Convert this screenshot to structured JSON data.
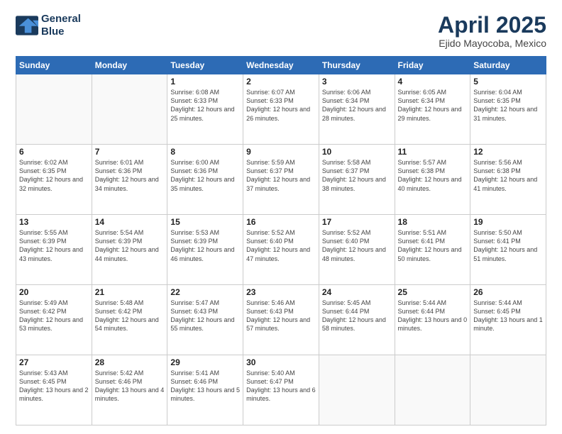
{
  "header": {
    "logo_line1": "General",
    "logo_line2": "Blue",
    "title": "April 2025",
    "subtitle": "Ejido Mayocoba, Mexico"
  },
  "days_of_week": [
    "Sunday",
    "Monday",
    "Tuesday",
    "Wednesday",
    "Thursday",
    "Friday",
    "Saturday"
  ],
  "weeks": [
    [
      {
        "num": "",
        "info": ""
      },
      {
        "num": "",
        "info": ""
      },
      {
        "num": "1",
        "info": "Sunrise: 6:08 AM\nSunset: 6:33 PM\nDaylight: 12 hours and 25 minutes."
      },
      {
        "num": "2",
        "info": "Sunrise: 6:07 AM\nSunset: 6:33 PM\nDaylight: 12 hours and 26 minutes."
      },
      {
        "num": "3",
        "info": "Sunrise: 6:06 AM\nSunset: 6:34 PM\nDaylight: 12 hours and 28 minutes."
      },
      {
        "num": "4",
        "info": "Sunrise: 6:05 AM\nSunset: 6:34 PM\nDaylight: 12 hours and 29 minutes."
      },
      {
        "num": "5",
        "info": "Sunrise: 6:04 AM\nSunset: 6:35 PM\nDaylight: 12 hours and 31 minutes."
      }
    ],
    [
      {
        "num": "6",
        "info": "Sunrise: 6:02 AM\nSunset: 6:35 PM\nDaylight: 12 hours and 32 minutes."
      },
      {
        "num": "7",
        "info": "Sunrise: 6:01 AM\nSunset: 6:36 PM\nDaylight: 12 hours and 34 minutes."
      },
      {
        "num": "8",
        "info": "Sunrise: 6:00 AM\nSunset: 6:36 PM\nDaylight: 12 hours and 35 minutes."
      },
      {
        "num": "9",
        "info": "Sunrise: 5:59 AM\nSunset: 6:37 PM\nDaylight: 12 hours and 37 minutes."
      },
      {
        "num": "10",
        "info": "Sunrise: 5:58 AM\nSunset: 6:37 PM\nDaylight: 12 hours and 38 minutes."
      },
      {
        "num": "11",
        "info": "Sunrise: 5:57 AM\nSunset: 6:38 PM\nDaylight: 12 hours and 40 minutes."
      },
      {
        "num": "12",
        "info": "Sunrise: 5:56 AM\nSunset: 6:38 PM\nDaylight: 12 hours and 41 minutes."
      }
    ],
    [
      {
        "num": "13",
        "info": "Sunrise: 5:55 AM\nSunset: 6:39 PM\nDaylight: 12 hours and 43 minutes."
      },
      {
        "num": "14",
        "info": "Sunrise: 5:54 AM\nSunset: 6:39 PM\nDaylight: 12 hours and 44 minutes."
      },
      {
        "num": "15",
        "info": "Sunrise: 5:53 AM\nSunset: 6:39 PM\nDaylight: 12 hours and 46 minutes."
      },
      {
        "num": "16",
        "info": "Sunrise: 5:52 AM\nSunset: 6:40 PM\nDaylight: 12 hours and 47 minutes."
      },
      {
        "num": "17",
        "info": "Sunrise: 5:52 AM\nSunset: 6:40 PM\nDaylight: 12 hours and 48 minutes."
      },
      {
        "num": "18",
        "info": "Sunrise: 5:51 AM\nSunset: 6:41 PM\nDaylight: 12 hours and 50 minutes."
      },
      {
        "num": "19",
        "info": "Sunrise: 5:50 AM\nSunset: 6:41 PM\nDaylight: 12 hours and 51 minutes."
      }
    ],
    [
      {
        "num": "20",
        "info": "Sunrise: 5:49 AM\nSunset: 6:42 PM\nDaylight: 12 hours and 53 minutes."
      },
      {
        "num": "21",
        "info": "Sunrise: 5:48 AM\nSunset: 6:42 PM\nDaylight: 12 hours and 54 minutes."
      },
      {
        "num": "22",
        "info": "Sunrise: 5:47 AM\nSunset: 6:43 PM\nDaylight: 12 hours and 55 minutes."
      },
      {
        "num": "23",
        "info": "Sunrise: 5:46 AM\nSunset: 6:43 PM\nDaylight: 12 hours and 57 minutes."
      },
      {
        "num": "24",
        "info": "Sunrise: 5:45 AM\nSunset: 6:44 PM\nDaylight: 12 hours and 58 minutes."
      },
      {
        "num": "25",
        "info": "Sunrise: 5:44 AM\nSunset: 6:44 PM\nDaylight: 13 hours and 0 minutes."
      },
      {
        "num": "26",
        "info": "Sunrise: 5:44 AM\nSunset: 6:45 PM\nDaylight: 13 hours and 1 minute."
      }
    ],
    [
      {
        "num": "27",
        "info": "Sunrise: 5:43 AM\nSunset: 6:45 PM\nDaylight: 13 hours and 2 minutes."
      },
      {
        "num": "28",
        "info": "Sunrise: 5:42 AM\nSunset: 6:46 PM\nDaylight: 13 hours and 4 minutes."
      },
      {
        "num": "29",
        "info": "Sunrise: 5:41 AM\nSunset: 6:46 PM\nDaylight: 13 hours and 5 minutes."
      },
      {
        "num": "30",
        "info": "Sunrise: 5:40 AM\nSunset: 6:47 PM\nDaylight: 13 hours and 6 minutes."
      },
      {
        "num": "",
        "info": ""
      },
      {
        "num": "",
        "info": ""
      },
      {
        "num": "",
        "info": ""
      }
    ]
  ]
}
